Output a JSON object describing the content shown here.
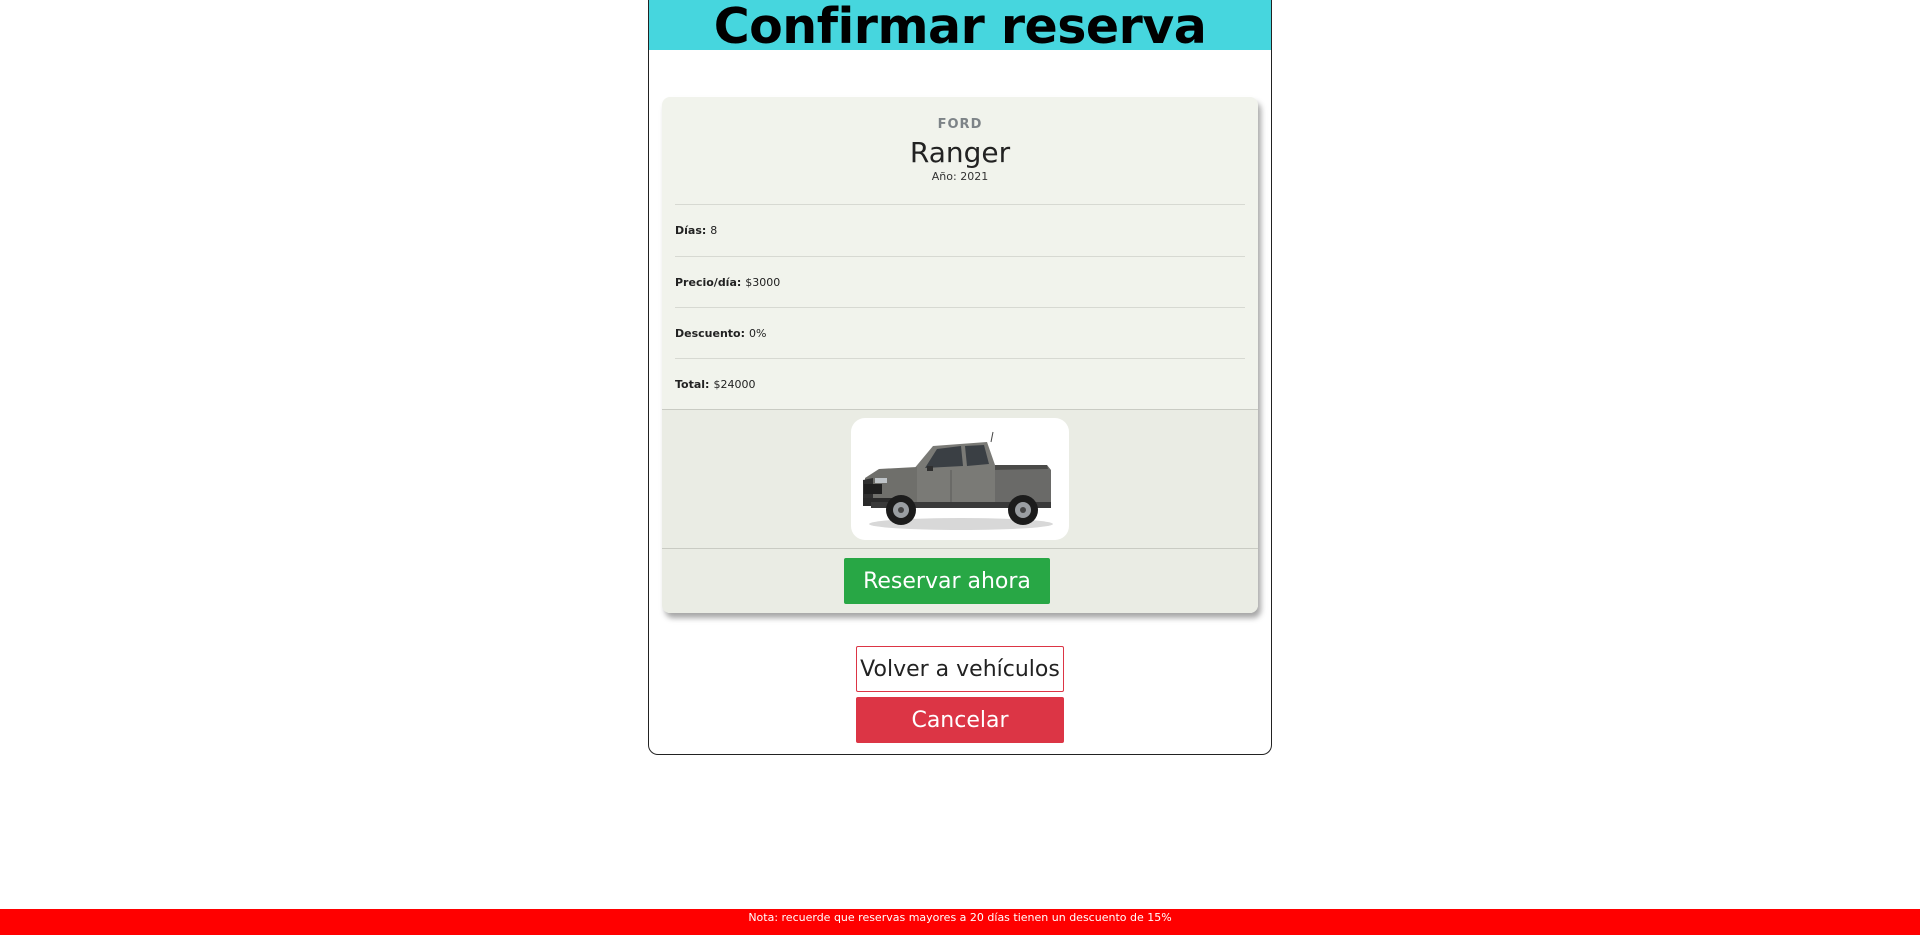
{
  "header": {
    "title": "Confirmar reserva"
  },
  "vehicle": {
    "brand": "FORD",
    "model": "Ranger",
    "year_label": "Año: 2021",
    "image_alt": "Ford Ranger pickup"
  },
  "details": [
    {
      "label": "Días:",
      "value": "8"
    },
    {
      "label": "Precio/día:",
      "value": "$3000"
    },
    {
      "label": "Descuento:",
      "value": "0%"
    },
    {
      "label": "Total:",
      "value": "$24000"
    }
  ],
  "actions": {
    "reserve_label": "Reservar ahora",
    "back_label": "Volver a vehículos",
    "cancel_label": "Cancelar"
  },
  "footer": {
    "note": "Nota: recuerde que reservas mayores a 20 días tienen un descuento de 15%"
  },
  "colors": {
    "title_bar": "#46d6de",
    "success": "#28a745",
    "danger": "#dc3545",
    "note_bar": "#ff0000",
    "card_bg": "#f1f3ec"
  },
  "icons": {
    "vehicle_image": "pickup-truck-image"
  }
}
